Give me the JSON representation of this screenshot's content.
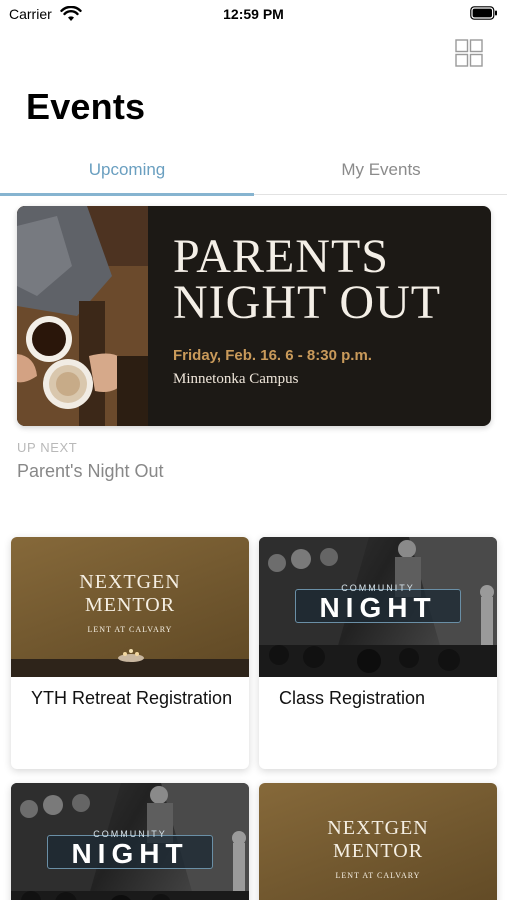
{
  "status_bar": {
    "carrier": "Carrier",
    "time": "12:59 PM"
  },
  "header": {
    "title": "Events",
    "view_toggle_icon": "grid-icon"
  },
  "tabs": [
    {
      "label": "Upcoming",
      "selected": true
    },
    {
      "label": "My Events",
      "selected": false
    }
  ],
  "featured": {
    "banner": {
      "title_line1": "PARENTS",
      "title_line2": "NIGHT OUT",
      "date": "Friday, Feb. 16. 6 - 8:30 p.m.",
      "campus": "Minnetonka Campus"
    },
    "up_next_label": "UP NEXT",
    "up_next_title": "Parent's Night Out"
  },
  "cards": [
    {
      "title": "YTH Retreat Registration",
      "image": {
        "type": "nextgen",
        "line1": "NEXTGEN",
        "line2": "MENTOR",
        "line3": "LENT AT CALVARY"
      }
    },
    {
      "title": "Class Registration",
      "image": {
        "type": "community",
        "top_word": "COMMUNITY",
        "main_word": "NIGHT"
      }
    },
    {
      "title": "",
      "image": {
        "type": "community",
        "top_word": "COMMUNITY",
        "main_word": "NIGHT"
      }
    },
    {
      "title": "",
      "image": {
        "type": "nextgen",
        "line1": "NEXTGEN",
        "line2": "MENTOR",
        "line3": "LENT AT CALVARY"
      }
    }
  ],
  "colors": {
    "tab_active": "#6a9fc0",
    "tab_inactive": "#8b8b8b",
    "banner_accent": "#c99a5a"
  }
}
